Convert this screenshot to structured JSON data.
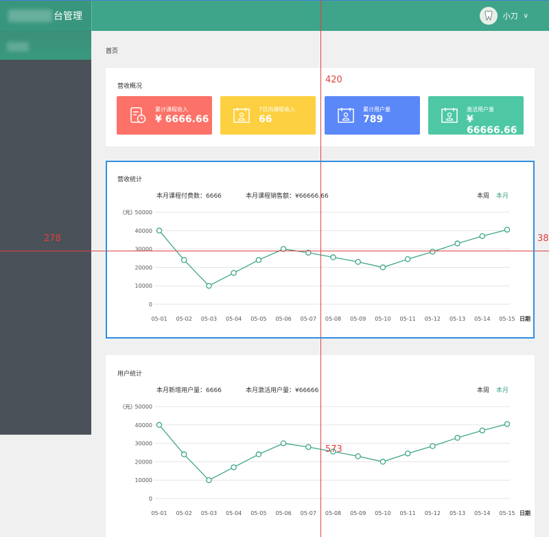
{
  "header": {
    "title": "台管理",
    "user_name": "小刀"
  },
  "breadcrumb": "首页",
  "revenue_overview": {
    "title": "营收概况",
    "kpis": [
      {
        "label": "累计课程收入",
        "value": "¥ 6666.66",
        "color": "#fc7268",
        "icon": "receipt-clock-icon"
      },
      {
        "label": "7日内课程收入",
        "value": "66",
        "color": "#fcd040",
        "icon": "calendar-user-icon"
      },
      {
        "label": "累计用户量",
        "value": "789",
        "color": "#5b88f8",
        "icon": "calendar-user-icon"
      },
      {
        "label": "激活用户量",
        "value": "¥ 66666.66",
        "color": "#4ec8a4",
        "icon": "calendar-user-icon"
      }
    ]
  },
  "revenue_stats": {
    "title": "营收统计",
    "stat1": "本月课程付费数：6666",
    "stat2": "本月课程销售额：¥66666.66",
    "toggle_week": "本周",
    "toggle_month": "本月"
  },
  "user_stats": {
    "title": "用户统计",
    "stat1": "本月新增用户量：6666",
    "stat2": "本月激活用户量：¥66666",
    "toggle_week": "本周",
    "toggle_month": "本月"
  },
  "guides": {
    "v_label": "420",
    "h_left": "278",
    "h_right": "38",
    "mid": "573"
  },
  "chart_data": [
    {
      "type": "line",
      "ylabel": "（元）",
      "xlabel": "日期",
      "ylim": [
        0,
        50000
      ],
      "yticks": [
        0,
        10000,
        20000,
        30000,
        40000,
        50000
      ],
      "categories": [
        "05-01",
        "05-02",
        "05-03",
        "05-04",
        "05-05",
        "05-06",
        "05-07",
        "05-08",
        "05-09",
        "05-10",
        "05-11",
        "05-12",
        "05-13",
        "05-14",
        "05-15"
      ],
      "values": [
        40000,
        24000,
        10000,
        17000,
        24000,
        30000,
        28000,
        25500,
        23000,
        20000,
        24500,
        28500,
        33000,
        37000,
        40500
      ],
      "color": "#3ea58a"
    },
    {
      "type": "line",
      "ylabel": "（元）",
      "xlabel": "日期",
      "ylim": [
        0,
        50000
      ],
      "yticks": [
        0,
        10000,
        20000,
        30000,
        40000,
        50000
      ],
      "categories": [
        "05-01",
        "05-02",
        "05-03",
        "05-04",
        "05-05",
        "05-06",
        "05-07",
        "05-08",
        "05-09",
        "05-10",
        "05-11",
        "05-12",
        "05-13",
        "05-14",
        "05-15"
      ],
      "values": [
        40000,
        24000,
        10000,
        17000,
        24000,
        30000,
        28000,
        25500,
        23000,
        20000,
        24500,
        28500,
        33000,
        37000,
        40500
      ],
      "color": "#3ea58a"
    }
  ]
}
